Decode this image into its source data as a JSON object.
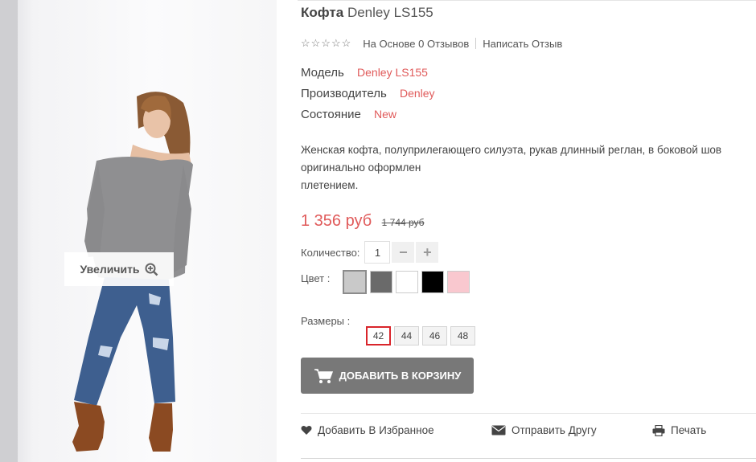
{
  "product": {
    "title_brand": "Кофта",
    "title_rest": "Denley LS155",
    "stars": "☆☆☆☆☆",
    "reviews": "На Основе 0 Отзывов",
    "write_review": "Написать Отзыв",
    "attributes": [
      {
        "label": "Модель",
        "value": "Denley LS155"
      },
      {
        "label": "Производитель",
        "value": "Denley"
      },
      {
        "label": "Состояние",
        "value": "New"
      }
    ],
    "description_lines": [
      "Женская кофта, полуприлегающего силуэта, рукав длинный реглан, в боковой шов",
      "оригинально оформлен",
      "плетением."
    ],
    "price_new": "1 356 руб",
    "price_old": "1 744 руб",
    "qty_label": "Количество:",
    "qty_value": "1",
    "qty_minus": "−",
    "qty_plus": "+",
    "color_label": "Цвет :",
    "colors": [
      "#c9c9c9",
      "#6a6a6a",
      "#ffffff",
      "#000000",
      "#f9c8cf"
    ],
    "sizes_label": "Размеры :",
    "sizes": [
      "42",
      "44",
      "46",
      "48"
    ],
    "cart_label": "ДОБАВИТЬ В КОРЗИНУ"
  },
  "image": {
    "zoom_label": "Увеличить"
  },
  "actions": {
    "wishlist": "Добавить В Избранное",
    "send_friend": "Отправить Другу",
    "print": "Печать"
  }
}
